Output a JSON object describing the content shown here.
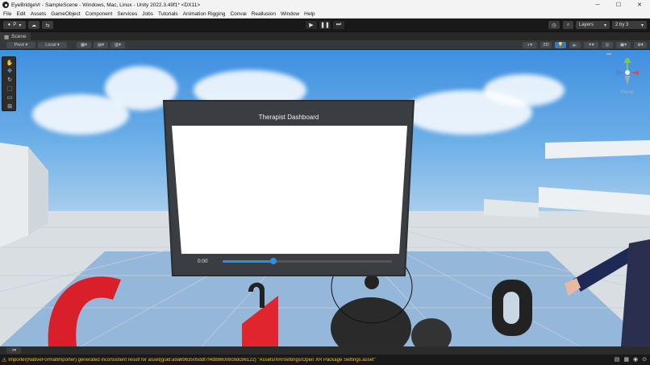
{
  "window": {
    "title": "EyeBridgeVr - SampleScene - Windows, Mac, Linux - Unity 2022.3.49f1* <DX11>",
    "minimize": "─",
    "maximize": "☐",
    "close": "✕"
  },
  "menu": [
    "File",
    "Edit",
    "Assets",
    "GameObject",
    "Component",
    "Services",
    "Jobs",
    "Tutorials",
    "Animation Rigging",
    "Convai",
    "Reallusion",
    "Window",
    "Help"
  ],
  "toolbar": {
    "account_label": "P",
    "layers_label": "Layers",
    "layout_label": "2 by 3"
  },
  "scene": {
    "tab_label": "Scene",
    "pivot_label": "Pivot",
    "local_label": "Local",
    "mode_2d_label": "2D",
    "persp_label": "Persp"
  },
  "dashboard": {
    "title": "Therapist Dashboard",
    "time": "0:00",
    "progress": 0.3
  },
  "status": {
    "message": "Importer(NativeFormatImporter) generated inconsistent result for asset(guid:a9a6963505ddf7f4d886008c6dc86122) \"Assets/XR/Settings/Open XR Package Settings.asset\""
  },
  "colors": {
    "warning": "#ffc107",
    "progress": "#2f8de4",
    "sky_top": "#3f8fe0"
  }
}
